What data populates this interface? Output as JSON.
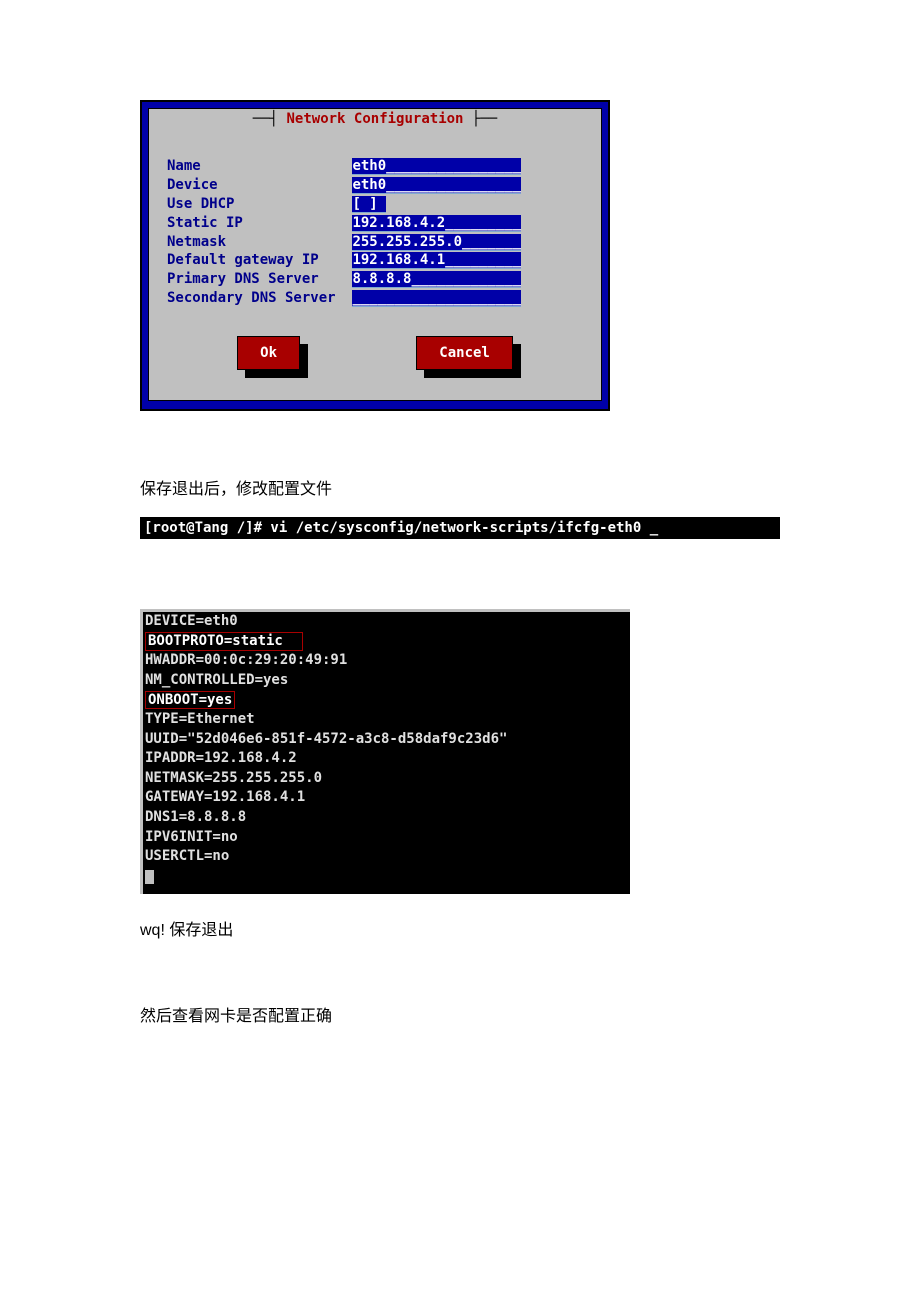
{
  "dialog": {
    "title": "Network Configuration",
    "fields": [
      {
        "label": "Name",
        "value": "eth0"
      },
      {
        "label": "Device",
        "value": "eth0"
      },
      {
        "label": "Use DHCP",
        "value": "[ ]"
      },
      {
        "label": "Static IP",
        "value": "192.168.4.2"
      },
      {
        "label": "Netmask",
        "value": "255.255.255.0"
      },
      {
        "label": "Default gateway IP",
        "value": "192.168.4.1"
      },
      {
        "label": "Primary DNS Server",
        "value": "8.8.8.8"
      },
      {
        "label": "Secondary DNS Server",
        "value": ""
      }
    ],
    "ok": "Ok",
    "cancel": "Cancel"
  },
  "para1": "保存退出后，修改配置文件",
  "cmd1": "[root@Tang /]# vi /etc/sysconfig/network-scripts/ifcfg-eth0 _",
  "editor": {
    "lines": [
      {
        "text": "DEVICE=eth0",
        "hl": false
      },
      {
        "text": "BOOTPROTO=static  ",
        "hl": true
      },
      {
        "text": "HWADDR=00:0c:29:20:49:91",
        "hl": false
      },
      {
        "text": "NM_CONTROLLED=yes",
        "hl": false
      },
      {
        "text": "ONBOOT=yes",
        "hl": true
      },
      {
        "text": "TYPE=Ethernet",
        "hl": false
      },
      {
        "text": "UUID=\"52d046e6-851f-4572-a3c8-d58daf9c23d6\"",
        "hl": false
      },
      {
        "text": "IPADDR=192.168.4.2",
        "hl": false
      },
      {
        "text": "NETMASK=255.255.255.0",
        "hl": false
      },
      {
        "text": "GATEWAY=192.168.4.1",
        "hl": false
      },
      {
        "text": "DNS1=8.8.8.8",
        "hl": false
      },
      {
        "text": "IPV6INIT=no",
        "hl": false
      },
      {
        "text": "USERCTL=no",
        "hl": false
      }
    ]
  },
  "para2": "wq! 保存退出",
  "para3": "然后查看网卡是否配置正确"
}
